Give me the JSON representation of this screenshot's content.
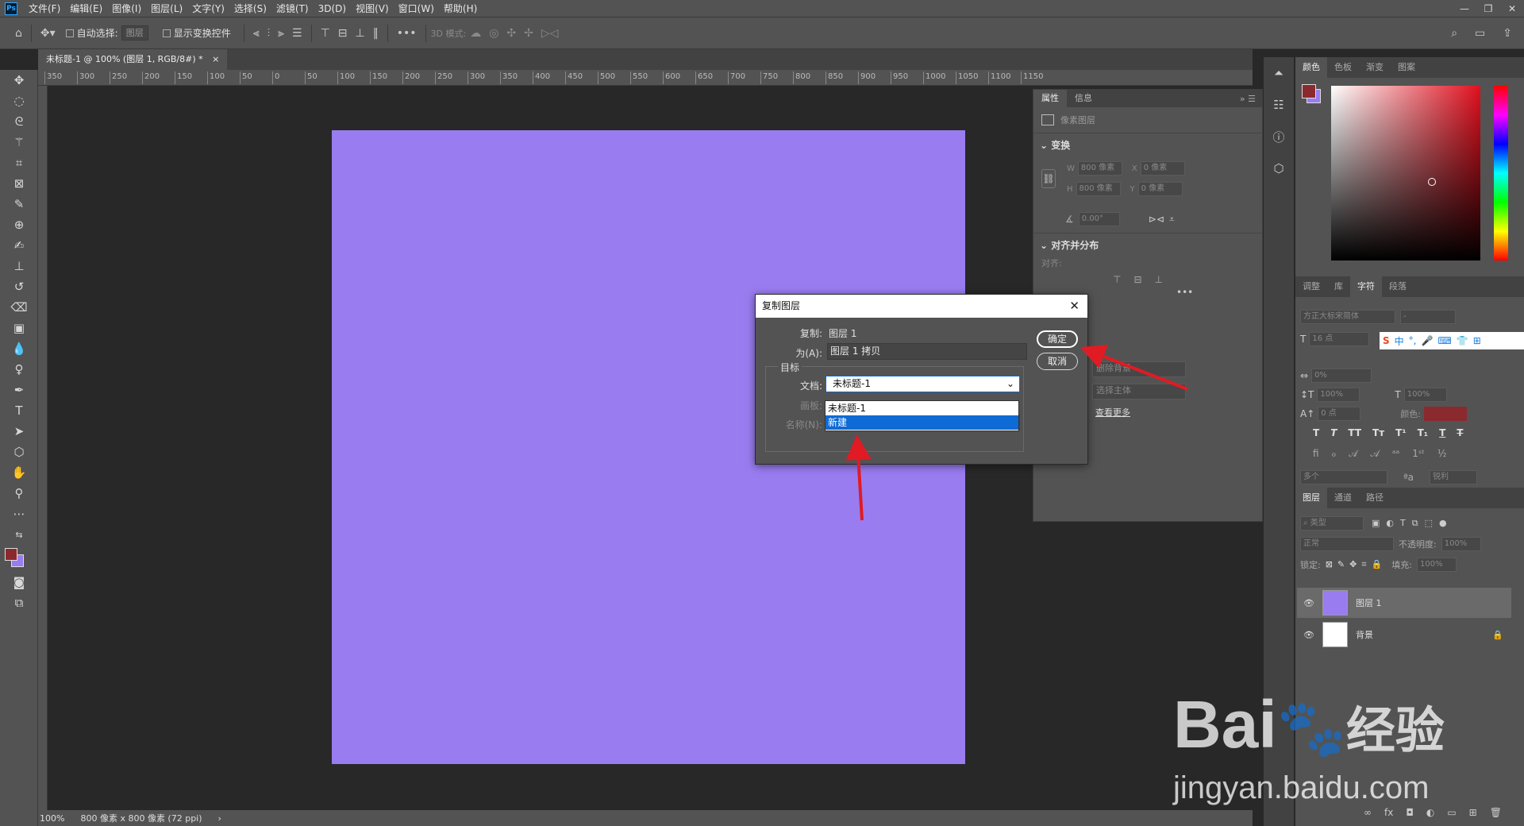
{
  "menubar": {
    "app_icon": "Ps",
    "items": [
      "文件(F)",
      "编辑(E)",
      "图像(I)",
      "图层(L)",
      "文字(Y)",
      "选择(S)",
      "滤镜(T)",
      "3D(D)",
      "视图(V)",
      "窗口(W)",
      "帮助(H)"
    ]
  },
  "options": {
    "auto_select_label": "自动选择:",
    "auto_select_value": "图层",
    "transform_label": "显示变换控件",
    "mode3d_label": "3D 模式:"
  },
  "doc_tab": {
    "title": "未标题-1 @ 100% (图层 1, RGB/8#) *",
    "close": "×"
  },
  "ruler_ticks": [
    "350",
    "300",
    "250",
    "200",
    "150",
    "100",
    "50",
    "0",
    "50",
    "100",
    "150",
    "200",
    "250",
    "300",
    "350",
    "400",
    "450",
    "500",
    "550",
    "600",
    "650",
    "700",
    "750",
    "800",
    "850",
    "900",
    "950",
    "1000",
    "1050",
    "1100",
    "1150"
  ],
  "status": {
    "zoom": "100%",
    "doc_size": "800 像素 x 800 像素 (72 ppi)",
    "arrow": "›"
  },
  "properties": {
    "tabs": [
      "属性",
      "信息"
    ],
    "kind": "像素图层",
    "transform_title": "变换",
    "w_label": "W",
    "w_value": "800 像素",
    "x_label": "X",
    "x_value": "0 像素",
    "h_label": "H",
    "h_value": "800 像素",
    "y_label": "Y",
    "y_value": "0 像素",
    "angle_value": "0.00°",
    "align_title": "对齐并分布",
    "align_label": "对齐:",
    "btn_remove_bg": "删除背景",
    "btn_select_subject": "选择主体",
    "more_link": "查看更多"
  },
  "color_panel": {
    "tabs": [
      "颜色",
      "色板",
      "渐变",
      "图案"
    ],
    "fg": "#8b2a2e",
    "bg": "#9a7cf1"
  },
  "char_panel": {
    "tabs": [
      "调整",
      "库",
      "字符",
      "段落"
    ],
    "font_family": "方正大标宋简体",
    "font_style": "-",
    "size": "16 点",
    "tracking": "0%",
    "vscale": "100%",
    "hscale": "100%",
    "baseline": "0 点",
    "color_label": "颜色:",
    "lang": "多个",
    "aa": "锐利"
  },
  "ime_bar": {
    "items": [
      "S",
      "中",
      "°,",
      "🎤",
      "⌨",
      "👕",
      "⊞"
    ]
  },
  "layers_panel": {
    "tabs": [
      "图层",
      "通道",
      "路径"
    ],
    "filter_label": "类型",
    "blend_mode": "正常",
    "opacity_label": "不透明度:",
    "opacity_value": "100%",
    "lock_label": "锁定:",
    "fill_label": "填充:",
    "fill_value": "100%",
    "layers": [
      {
        "name": "图层 1",
        "color": "#9a7cf1"
      },
      {
        "name": "背景",
        "color": "#ffffff"
      }
    ]
  },
  "dialog": {
    "title": "复制图层",
    "copy_label": "复制:",
    "copy_value": "图层 1",
    "as_label": "为(A):",
    "as_value": "图层 1 拷贝",
    "target_group": "目标",
    "doc_label": "文档:",
    "doc_value": "未标题-1",
    "artboard_label": "画板:",
    "name_label": "名称(N):",
    "ok": "确定",
    "cancel": "取消",
    "dropdown_options": [
      "未标题-1",
      "新建"
    ],
    "selected_option": "新建"
  },
  "watermark": {
    "brand": "Bai",
    "brand2": "经验",
    "url": "jingyan.baidu.com"
  }
}
